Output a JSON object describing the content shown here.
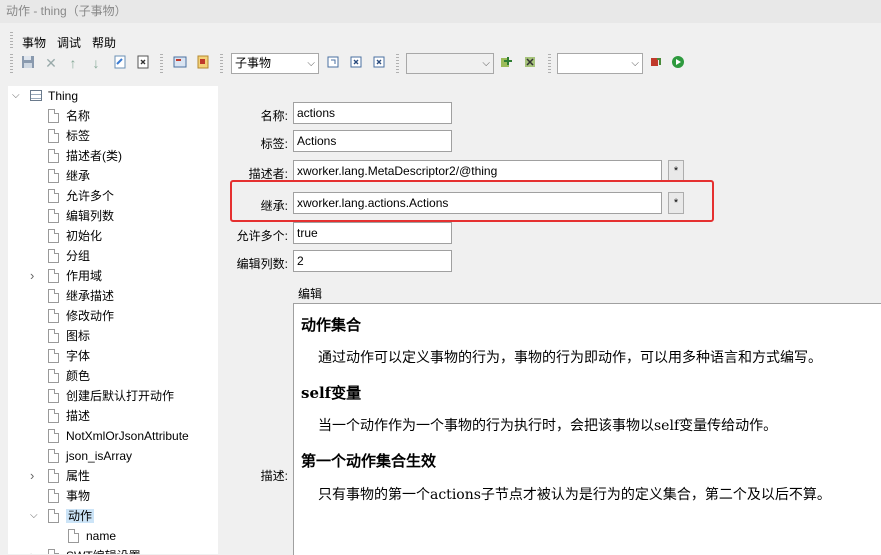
{
  "window": {
    "title": "动作 - thing（子事物）"
  },
  "menu": [
    "事物",
    "调试",
    "帮助"
  ],
  "toolbar": {
    "child_combo": "子事物",
    "empty_combo1": "",
    "empty_combo2": "",
    "icons": [
      "save-icon",
      "delete-icon",
      "up-icon",
      "down-icon",
      "refresh-icon",
      "remove-icon",
      "doc-icon",
      "bookmark-icon",
      "child-add-icon",
      "child-remove-icon",
      "child-x-icon",
      "add-green-icon",
      "remove-green-icon",
      "debug-icon",
      "run-icon"
    ]
  },
  "tree": {
    "root": "Thing",
    "items": [
      {
        "label": "名称",
        "expandable": false
      },
      {
        "label": "标签",
        "expandable": false
      },
      {
        "label": "描述者(类)",
        "expandable": false
      },
      {
        "label": "继承",
        "expandable": false
      },
      {
        "label": "允许多个",
        "expandable": false
      },
      {
        "label": "编辑列数",
        "expandable": false
      },
      {
        "label": "初始化",
        "expandable": false
      },
      {
        "label": "分组",
        "expandable": false
      },
      {
        "label": "作用域",
        "expandable": true
      },
      {
        "label": "继承描述",
        "expandable": false
      },
      {
        "label": "修改动作",
        "expandable": false
      },
      {
        "label": "图标",
        "expandable": false
      },
      {
        "label": "字体",
        "expandable": false
      },
      {
        "label": "颜色",
        "expandable": false
      },
      {
        "label": "创建后默认打开动作",
        "expandable": false
      },
      {
        "label": "描述",
        "expandable": false
      },
      {
        "label": "NotXmlOrJsonAttribute",
        "expandable": false
      },
      {
        "label": "json_isArray",
        "expandable": false
      },
      {
        "label": "属性",
        "expandable": true
      },
      {
        "label": "事物",
        "expandable": false
      },
      {
        "label": "动作",
        "expandable": true,
        "selected": true
      },
      {
        "label": "name",
        "expandable": false,
        "child": true
      },
      {
        "label": "SWT编辑设置",
        "expandable": true
      }
    ]
  },
  "form": {
    "name_label": "名称:",
    "name_value": "actions",
    "tag_label": "标签:",
    "tag_value": "Actions",
    "descriptor_label": "描述者:",
    "descriptor_value": "xworker.lang.MetaDescriptor2/@thing",
    "extends_label": "继承:",
    "extends_value": "xworker.lang.actions.Actions",
    "multiple_label": "允许多个:",
    "multiple_value": "true",
    "cols_label": "编辑列数:",
    "cols_value": "2",
    "star": "*",
    "editor_caption": "编辑",
    "desc_label": "描述:"
  },
  "description": {
    "h1": "动作集合",
    "p1": "通过动作可以定义事物的行为，事物的行为即动作，可以用多种语言和方式编写。",
    "h2": "self变量",
    "p2": "当一个动作作为一个事物的行为执行时，会把该事物以self变量传给动作。",
    "h3": "第一个动作集合生效",
    "p3": "只有事物的第一个actions子节点才被认为是行为的定义集合，第二个及以后不算。"
  }
}
